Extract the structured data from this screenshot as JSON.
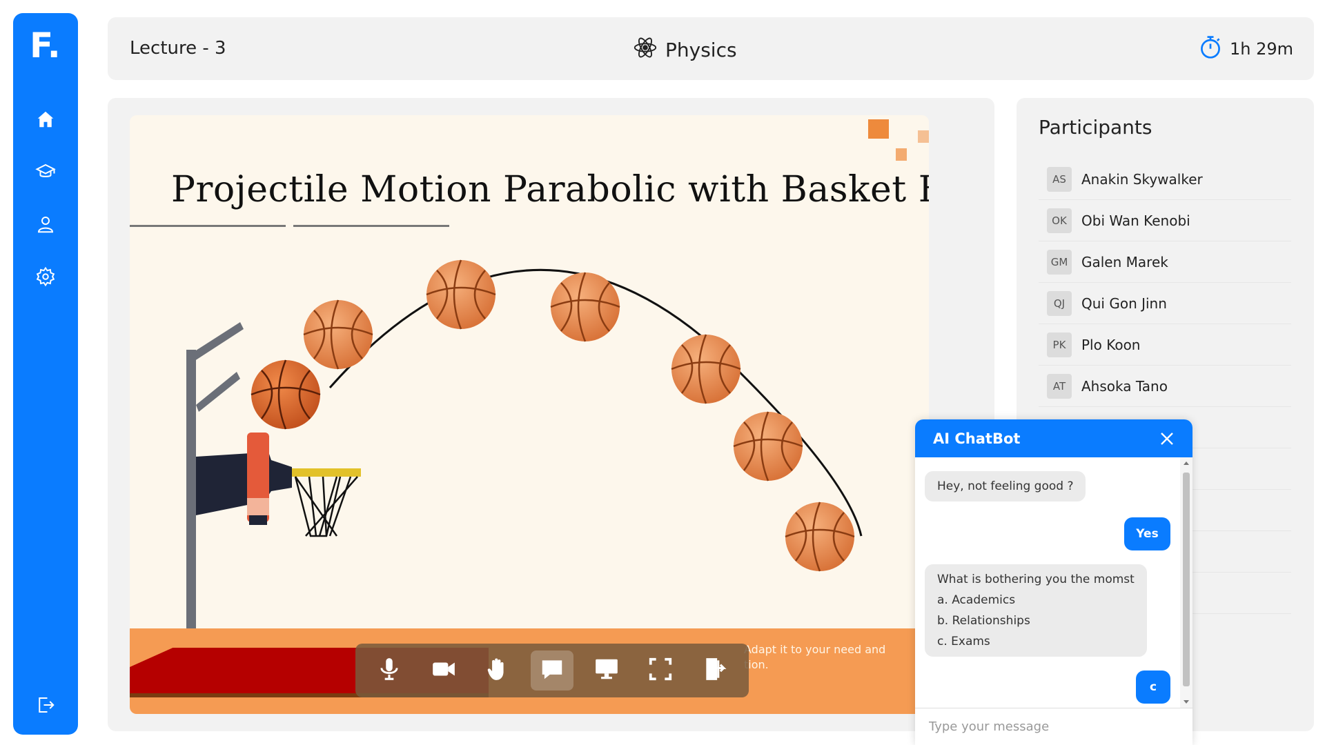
{
  "app": {
    "logo": "F."
  },
  "sidebar": {
    "items": [
      {
        "name": "home",
        "icon": "home-icon"
      },
      {
        "name": "courses",
        "icon": "graduation-cap-icon"
      },
      {
        "name": "profile",
        "icon": "user-icon"
      },
      {
        "name": "settings",
        "icon": "gear-icon"
      }
    ],
    "logout_icon": "logout-icon"
  },
  "header": {
    "lecture": "Lecture - 3",
    "subject": "Physics",
    "subject_icon": "atom-icon",
    "timer": "1h 29m",
    "timer_icon": "stopwatch-icon"
  },
  "slide": {
    "title": "Projectile Motion Parabolic with Basket Ball",
    "note_line1": "Adapt it to your need and",
    "note_line2": "tion."
  },
  "controls": [
    {
      "name": "microphone",
      "icon": "microphone-icon",
      "active": false
    },
    {
      "name": "camera",
      "icon": "video-camera-icon",
      "active": false
    },
    {
      "name": "raise-hand",
      "icon": "hand-icon",
      "active": false
    },
    {
      "name": "chat",
      "icon": "chat-bubble-icon",
      "active": true
    },
    {
      "name": "screen-share",
      "icon": "monitor-icon",
      "active": false
    },
    {
      "name": "fullscreen",
      "icon": "fullscreen-icon",
      "active": false
    },
    {
      "name": "leave",
      "icon": "exit-door-icon",
      "active": false
    }
  ],
  "participants": {
    "title": "Participants",
    "list": [
      {
        "initials": "AS",
        "name": "Anakin Skywalker"
      },
      {
        "initials": "OK",
        "name": "Obi Wan Kenobi"
      },
      {
        "initials": "GM",
        "name": "Galen Marek"
      },
      {
        "initials": "QJ",
        "name": "Qui Gon Jinn"
      },
      {
        "initials": "PK",
        "name": "Plo Koon"
      },
      {
        "initials": "AT",
        "name": "Ahsoka Tano"
      }
    ]
  },
  "chatbot": {
    "title": "AI ChatBot",
    "messages": [
      {
        "from": "bot",
        "lines": [
          "Hey, not feeling good ?"
        ]
      },
      {
        "from": "user",
        "lines": [
          "Yes"
        ]
      },
      {
        "from": "bot",
        "lines": [
          "What is bothering you the momst",
          "a. Academics",
          "b. Relationships",
          "c. Exams"
        ]
      },
      {
        "from": "user",
        "lines": [
          "c"
        ]
      }
    ],
    "input_placeholder": "Type your message",
    "input_value": ""
  },
  "colors": {
    "brand": "#0a7cff",
    "panel": "#f2f2f2",
    "ball": "#e8874a"
  }
}
